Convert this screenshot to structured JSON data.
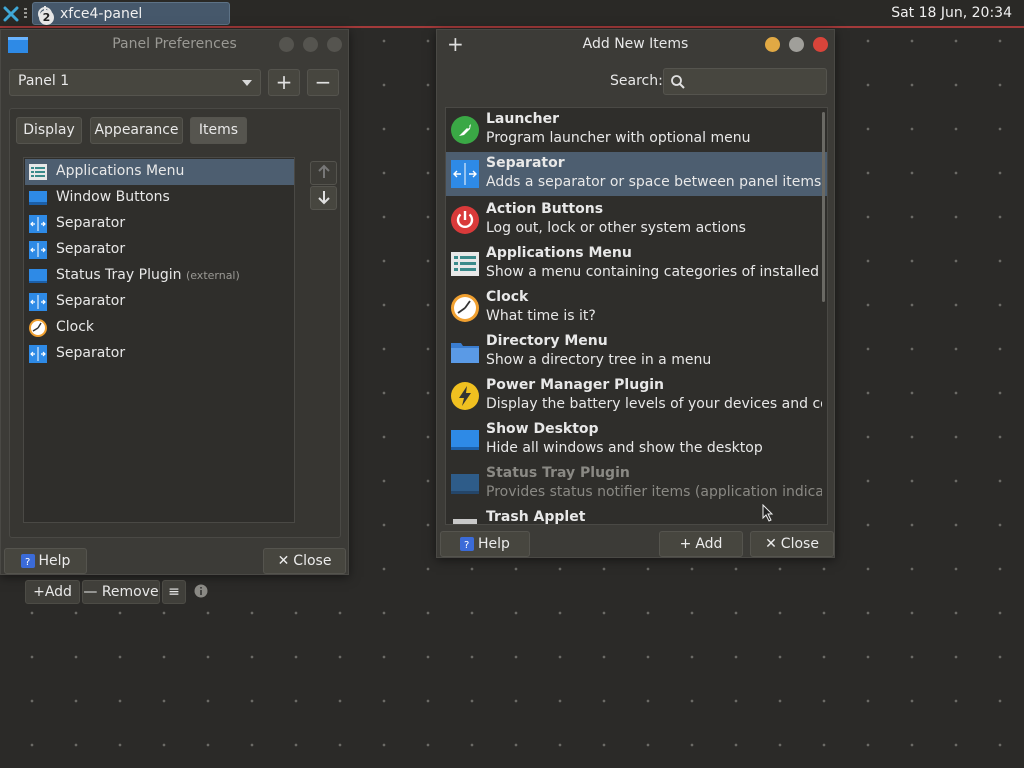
{
  "top_panel": {
    "task_label": "xfce4-panel",
    "badge_count": "2",
    "clock": "Sat 18 Jun, 20:34",
    "accent_color": "#a33a3a"
  },
  "panel_prefs": {
    "title": "Panel Preferences",
    "panel_select": "Panel 1",
    "tabs": [
      "Display",
      "Appearance",
      "Items"
    ],
    "active_tab": "Items",
    "items": [
      {
        "label": "Applications Menu",
        "icon": "applications-menu-icon",
        "extra": ""
      },
      {
        "label": "Window Buttons",
        "icon": "window-buttons-icon",
        "extra": ""
      },
      {
        "label": "Separator",
        "icon": "separator-icon",
        "extra": ""
      },
      {
        "label": "Separator",
        "icon": "separator-icon",
        "extra": ""
      },
      {
        "label": "Status Tray Plugin",
        "icon": "status-tray-icon",
        "extra": "(external)"
      },
      {
        "label": "Separator",
        "icon": "separator-icon",
        "extra": ""
      },
      {
        "label": "Clock",
        "icon": "clock-icon",
        "extra": ""
      },
      {
        "label": "Separator",
        "icon": "separator-icon",
        "extra": ""
      }
    ],
    "selected_item": 0,
    "add_label": "Add",
    "remove_label": "Remove",
    "help_label": "Help",
    "close_label": "Close"
  },
  "add_new_items": {
    "title": "Add New Items",
    "search_label": "Search:",
    "search_value": "",
    "plugins": [
      {
        "name": "Launcher",
        "desc": "Program launcher with optional menu",
        "icon": "launcher-icon"
      },
      {
        "name": "Separator",
        "desc": "Adds a separator or space between panel items",
        "icon": "separator-icon"
      },
      {
        "name": "Action Buttons",
        "desc": "Log out, lock or other system actions",
        "icon": "power-icon"
      },
      {
        "name": "Applications Menu",
        "desc": "Show a menu containing categories of installed applic…",
        "icon": "applications-menu-icon"
      },
      {
        "name": "Clock",
        "desc": "What time is it?",
        "icon": "clock-icon"
      },
      {
        "name": "Directory Menu",
        "desc": "Show a directory tree in a menu",
        "icon": "folder-icon"
      },
      {
        "name": "Power Manager Plugin",
        "desc": "Display the battery levels of your devices and control …",
        "icon": "lightning-icon"
      },
      {
        "name": "Show Desktop",
        "desc": "Hide all windows and show the desktop",
        "icon": "show-desktop-icon"
      },
      {
        "name": "Status Tray Plugin",
        "desc": "Provides status notifier items (application indicators) …",
        "icon": "status-tray-icon"
      },
      {
        "name": "Trash Applet",
        "desc": "",
        "icon": "trash-icon"
      }
    ],
    "selected_plugin": 1,
    "dimmed_plugin": 8,
    "help_label": "Help",
    "add_label": "Add",
    "close_label": "Close"
  }
}
